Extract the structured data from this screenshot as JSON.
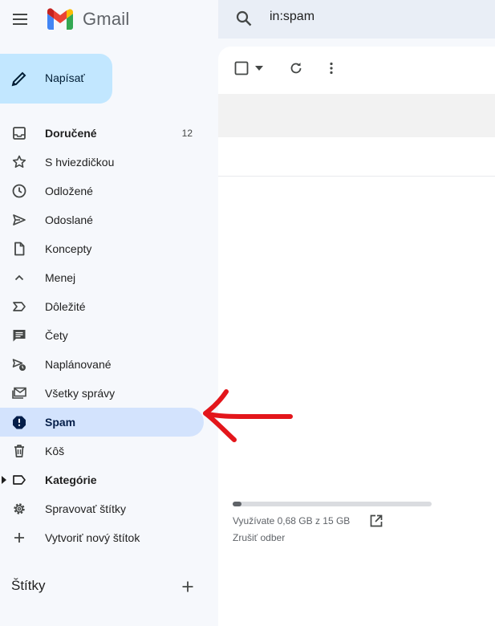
{
  "app": {
    "title": "Gmail"
  },
  "search": {
    "value": "in:spam"
  },
  "compose": {
    "label": "Napísať"
  },
  "nav": {
    "items": [
      {
        "label": "Doručené",
        "count": "12",
        "icon": "inbox-icon"
      },
      {
        "label": "S hviezdičkou",
        "icon": "star-icon"
      },
      {
        "label": "Odložené",
        "icon": "clock-icon"
      },
      {
        "label": "Odoslané",
        "icon": "send-icon"
      },
      {
        "label": "Koncepty",
        "icon": "draft-icon"
      },
      {
        "label": "Menej",
        "icon": "chevron-up-icon"
      },
      {
        "label": "Dôležité",
        "icon": "important-icon"
      },
      {
        "label": "Čety",
        "icon": "chat-icon"
      },
      {
        "label": "Naplánované",
        "icon": "scheduled-icon"
      },
      {
        "label": "Všetky správy",
        "icon": "all-mail-icon"
      },
      {
        "label": "Spam",
        "icon": "spam-icon"
      },
      {
        "label": "Kôš",
        "icon": "trash-icon"
      },
      {
        "label": "Kategórie",
        "icon": "label-icon"
      },
      {
        "label": "Spravovať štítky",
        "icon": "gear-icon"
      },
      {
        "label": "Vytvoriť nový štítok",
        "icon": "plus-icon"
      }
    ]
  },
  "labels_section": {
    "title": "Štítky"
  },
  "storage": {
    "used_fraction": 0.045,
    "text": "Využívate 0,68 GB z 15 GB",
    "unsubscribe": "Zrušiť odber"
  },
  "colors": {
    "background": "#f6f8fc",
    "compose": "#c2e7ff",
    "active_nav": "#d3e3fd",
    "annotation_arrow": "#e3161b"
  }
}
